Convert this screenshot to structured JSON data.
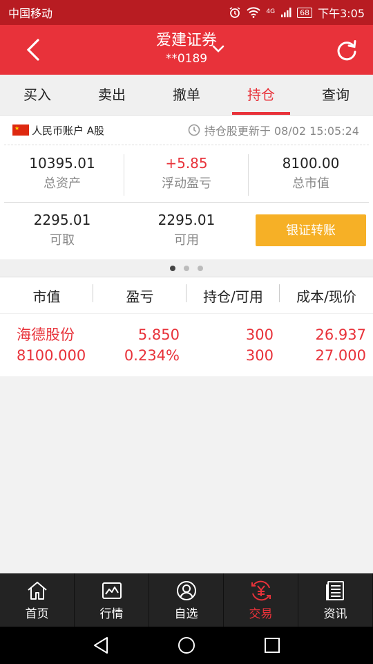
{
  "status_bar": {
    "carrier": "中国移动",
    "network": "4G",
    "battery": "68",
    "time": "下午3:05"
  },
  "header": {
    "title": "爱建证券",
    "account_masked": "**0189"
  },
  "tabs": [
    {
      "label": "买入"
    },
    {
      "label": "卖出"
    },
    {
      "label": "撤单"
    },
    {
      "label": "持仓",
      "active": true
    },
    {
      "label": "查询"
    }
  ],
  "account": {
    "type": "人民币账户 A股",
    "update_text": "持仓股更新于 08/02 15:05:24",
    "total_assets": {
      "value": "10395.01",
      "label": "总资产"
    },
    "floating_pnl": {
      "value": "+5.85",
      "label": "浮动盈亏"
    },
    "market_value": {
      "value": "8100.00",
      "label": "总市值"
    },
    "withdrawable": {
      "value": "2295.01",
      "label": "可取"
    },
    "available": {
      "value": "2295.01",
      "label": "可用"
    },
    "transfer_label": "银证转账"
  },
  "holdings": {
    "columns": [
      "市值",
      "盈亏",
      "持仓/可用",
      "成本/现价"
    ],
    "rows": [
      {
        "name": "海德股份",
        "market_value": "8100.000",
        "pnl": "5.850",
        "pnl_pct": "0.234%",
        "position": "300",
        "available": "300",
        "cost": "26.937",
        "price": "27.000"
      }
    ]
  },
  "bottom_nav": [
    {
      "label": "首页",
      "icon": "home-icon"
    },
    {
      "label": "行情",
      "icon": "chart-icon"
    },
    {
      "label": "自选",
      "icon": "user-icon"
    },
    {
      "label": "交易",
      "icon": "yuan-exchange-icon",
      "active": true
    },
    {
      "label": "资讯",
      "icon": "news-icon"
    }
  ],
  "colors": {
    "brand_red": "#e8323a",
    "status_red": "#b81c22",
    "accent_orange": "#f6b026",
    "nav_dark": "#232323"
  }
}
